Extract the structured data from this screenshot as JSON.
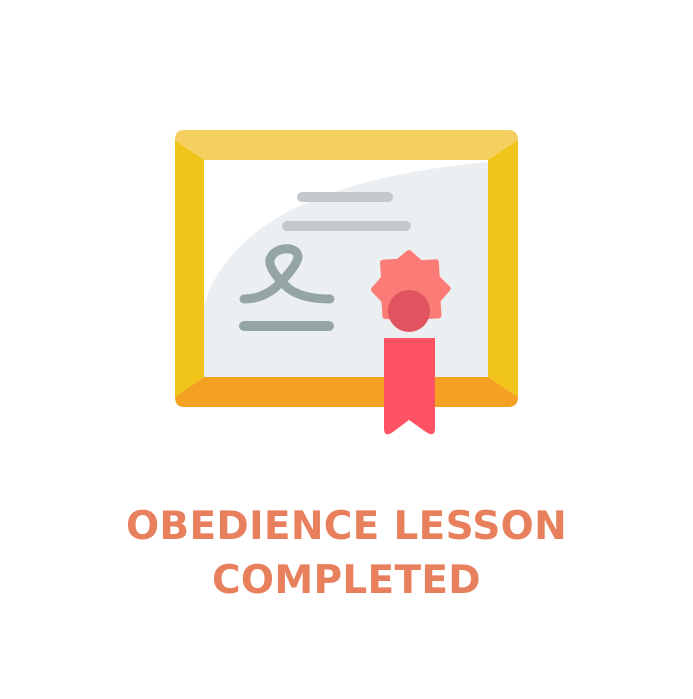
{
  "caption": {
    "line1": "OBEDIENCE LESSON",
    "line2": "COMPLETED"
  },
  "colors": {
    "caption": "#E8805D",
    "frame_top": "#F5D060",
    "frame_side": "#F0C419",
    "frame_bottom": "#F3A023",
    "paper": "#ECEFF1",
    "paper_shade": "#FFFFFF",
    "text_lines": "#C5C9CC",
    "signature": "#95A5A5",
    "seal": "#FB7B76",
    "seal_center": "#E0535F",
    "ribbon": "#FF5364"
  },
  "icons": {
    "certificate": "certificate-icon",
    "seal": "award-seal-icon"
  }
}
